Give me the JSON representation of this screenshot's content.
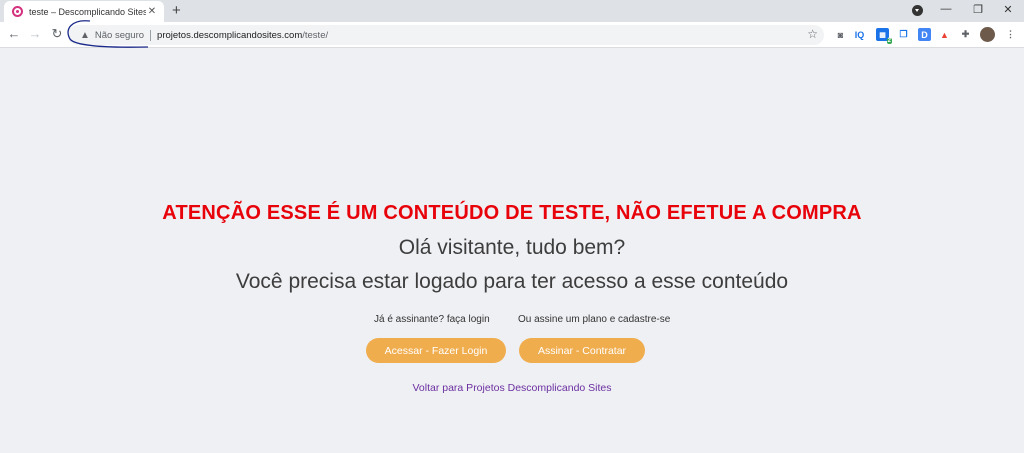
{
  "browser": {
    "tab_title": "teste – Descomplicando Sites",
    "tab_close": "✕",
    "new_tab": "+",
    "security_label": "Não seguro",
    "url_domain": "projetos.descomplicandosites.com",
    "url_path": "/teste/",
    "controls": {
      "minimize": "—",
      "restore": "❐",
      "close": "✕"
    },
    "extensions": [
      "camera-icon",
      "iq-icon",
      "grid-icon",
      "copy-icon",
      "d-icon",
      "bag-icon",
      "puzzle-icon",
      "avatar"
    ],
    "ext_labels": {
      "iq": "IQ",
      "d": "D",
      "grid_badge": "2"
    }
  },
  "page": {
    "warning": "ATENÇÃO ESSE É UM CONTEÚDO DE TESTE, NÃO EFETUE A COMPRA",
    "greeting": "Olá visitante, tudo bem?",
    "need_login": "Você precisa estar logado para ter acesso a esse conteúdo",
    "subscriber_hint": "Já é assinante? faça login",
    "signup_hint": "Ou assine um plano e cadastre-se",
    "login_button": "Acessar - Fazer Login",
    "subscribe_button": "Assinar - Contratar",
    "back_link": "Voltar para Projetos Descomplicando Sites"
  },
  "colors": {
    "warning": "#e8020a",
    "button": "#f0ad4e",
    "link": "#6b2fa0",
    "background": "#eff0f4"
  }
}
